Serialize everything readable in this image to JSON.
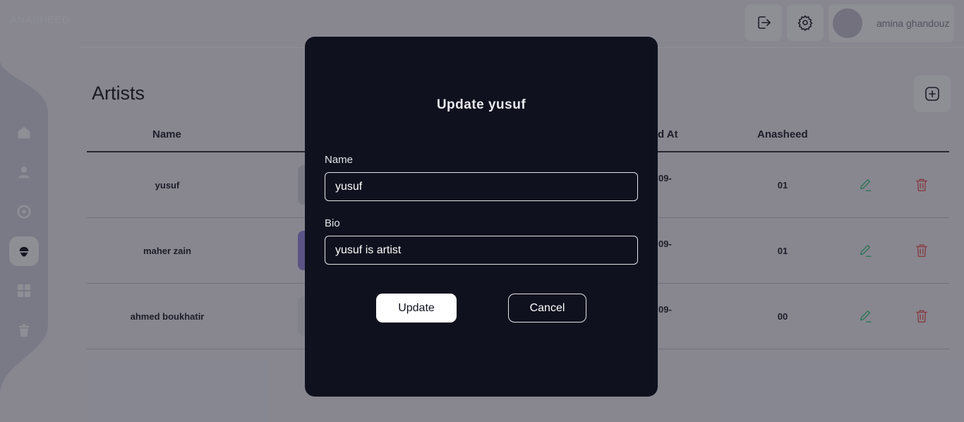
{
  "app": {
    "brand": "ANASHEED"
  },
  "sidebar": {
    "items": [
      {
        "icon": "home-icon",
        "active": false
      },
      {
        "icon": "user-icon",
        "active": false
      },
      {
        "icon": "disc-icon",
        "active": false
      },
      {
        "icon": "microphone-icon",
        "active": true
      },
      {
        "icon": "grid-icon",
        "active": false
      },
      {
        "icon": "trash-icon",
        "active": false
      }
    ]
  },
  "header": {
    "logout_icon": "logout-icon",
    "settings_icon": "gear-icon",
    "user_name": "amina ghandouz"
  },
  "page": {
    "title": "Artists",
    "add_icon": "plus-square-icon",
    "columns": {
      "name": "Name",
      "created": "d At",
      "anasheed": "Anasheed"
    },
    "rows": [
      {
        "name": "yusuf",
        "date": "09-",
        "count": "01",
        "thumb_color": "#d9d9de"
      },
      {
        "name": "maher zain",
        "date": "09-",
        "count": "01",
        "thumb_color": "#9b8fe0"
      },
      {
        "name": "ahmed boukhatir",
        "date": "09-",
        "count": "00",
        "thumb_color": "#e6e6ea"
      }
    ]
  },
  "modal": {
    "title": "Update yusuf",
    "name_label": "Name",
    "name_value": "yusuf",
    "bio_label": "Bio",
    "bio_value": "yusuf is artist",
    "update_label": "Update",
    "cancel_label": "Cancel"
  },
  "colors": {
    "accent_edit": "#4fd08a",
    "accent_delete": "#f06a6a",
    "modal_bg": "#0f111e",
    "sidebar_bg": "#d9d6e3"
  }
}
